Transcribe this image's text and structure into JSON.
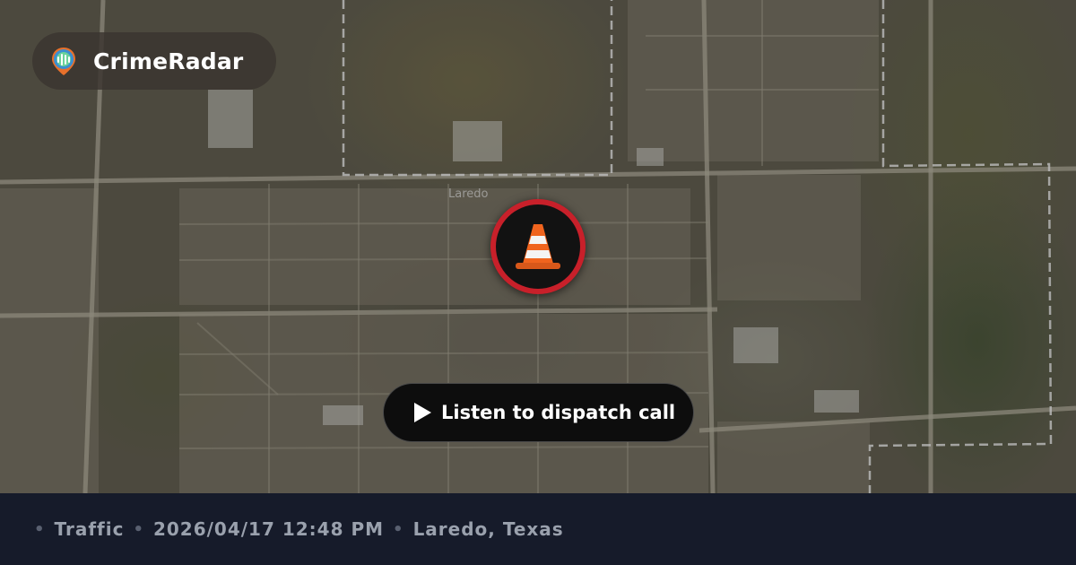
{
  "brand": {
    "name": "CrimeRadar"
  },
  "map": {
    "place_label": "Laredo"
  },
  "incident": {
    "icon": "traffic-cone-icon",
    "ring_color": "#c8202a"
  },
  "dispatch": {
    "listen_label": "Listen to dispatch call"
  },
  "footer": {
    "separator": "•",
    "category": "Traffic",
    "datetime": "2026/04/17 12:48 PM",
    "location": "Laredo, Texas"
  }
}
